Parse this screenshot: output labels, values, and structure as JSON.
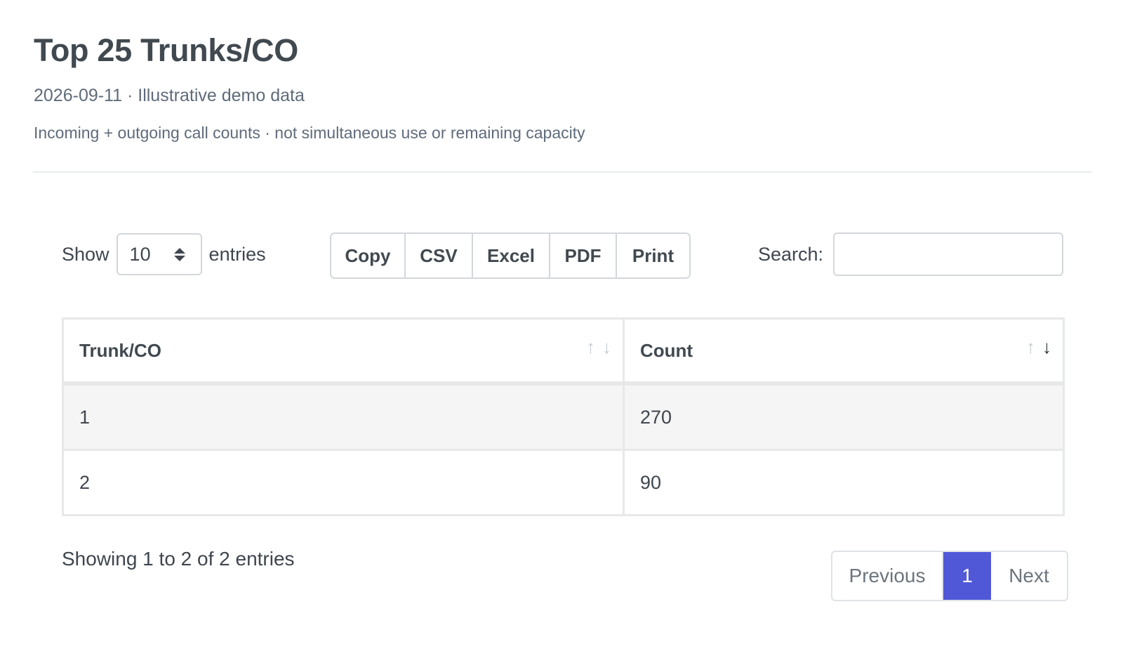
{
  "header": {
    "title": "Top 25 Trunks/CO",
    "subtitle": "2026-09-11 · Illustrative demo data",
    "note": "Incoming + outgoing call counts · not simultaneous use or remaining capacity"
  },
  "controls": {
    "show_label": "Show",
    "entries_label": "entries",
    "page_length": "10",
    "export_buttons": [
      "Copy",
      "CSV",
      "Excel",
      "PDF",
      "Print"
    ],
    "search_label": "Search:",
    "search_value": ""
  },
  "table": {
    "columns": [
      "Trunk/CO",
      "Count"
    ],
    "sorted_column": "Count",
    "sort_direction": "descending",
    "rows": [
      [
        "1",
        "270"
      ],
      [
        "2",
        "90"
      ]
    ]
  },
  "footer": {
    "info": "Showing 1 to 2 of 2 entries",
    "pagination": {
      "previous": "Previous",
      "current": "1",
      "next": "Next"
    }
  },
  "colors": {
    "accent": "#5058d8",
    "text": "#3f464f",
    "muted": "#5f6b7a",
    "border": "#e6e8ea",
    "stripe": "#f5f5f5"
  },
  "icons": {
    "sort_asc": "arrow-up-icon",
    "sort_desc": "arrow-down-icon",
    "select_caret": "updown-caret-icon"
  }
}
